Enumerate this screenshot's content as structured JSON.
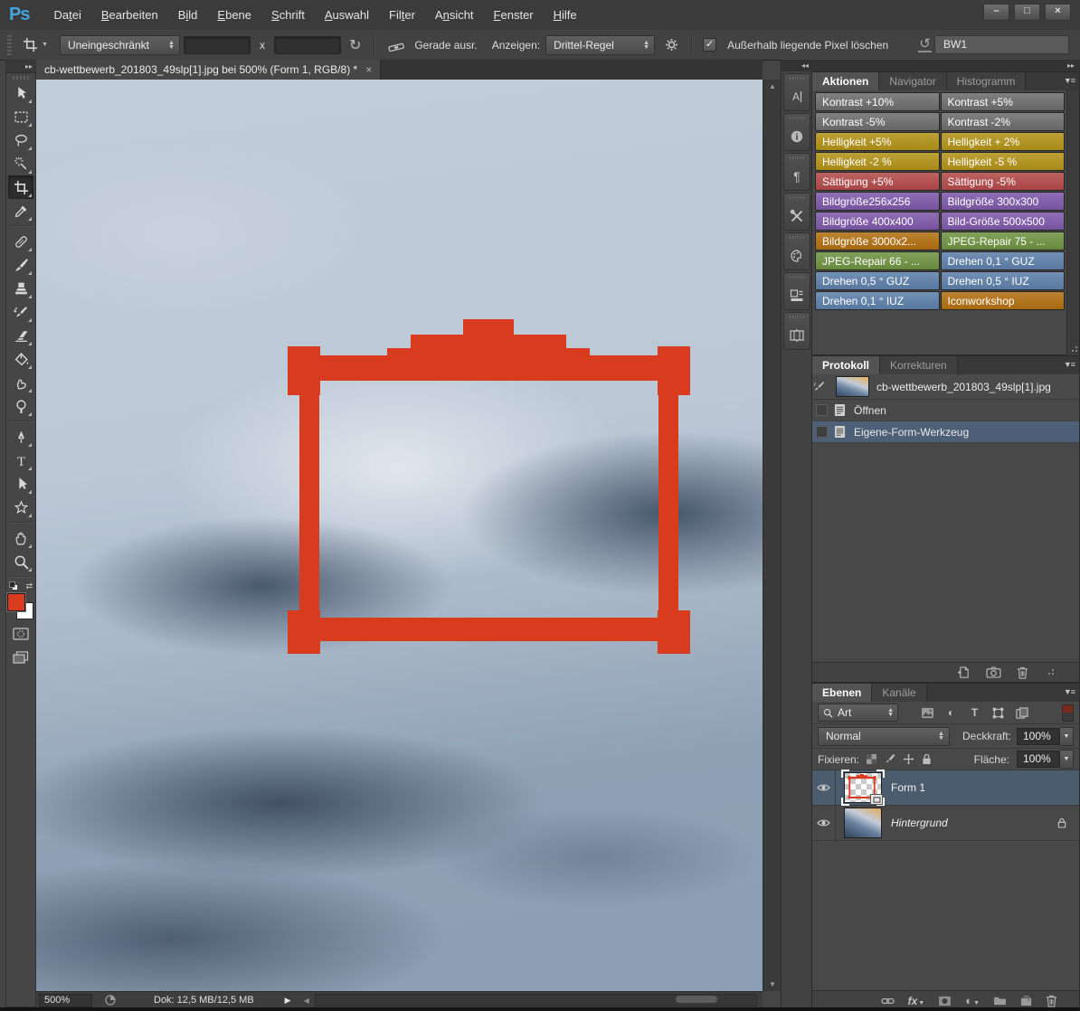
{
  "window": {
    "controls": [
      "–",
      "□",
      "×"
    ]
  },
  "menu_bar": {
    "logo": "Ps",
    "items": [
      {
        "label": "Datei",
        "u": 2
      },
      {
        "label": "Bearbeiten",
        "u": 0
      },
      {
        "label": "Bild",
        "u": 1
      },
      {
        "label": "Ebene",
        "u": 0
      },
      {
        "label": "Schrift",
        "u": 0
      },
      {
        "label": "Auswahl",
        "u": 0
      },
      {
        "label": "Filter",
        "u": 3
      },
      {
        "label": "Ansicht",
        "u": 1
      },
      {
        "label": "Fenster",
        "u": 0
      },
      {
        "label": "Hilfe",
        "u": 0
      }
    ]
  },
  "options_bar": {
    "tool": "crop",
    "aspect_select": "Uneingeschränkt",
    "width_value": "",
    "x_label": "x",
    "height_value": "",
    "straighten_label": "Gerade ausr.",
    "view_label": "Anzeigen:",
    "overlay_select": "Drittel-Regel",
    "delete_checkbox": {
      "checked": true,
      "check_glyph": "✓",
      "label": "Außerhalb liegende Pixel löschen"
    },
    "workspace_value": "BW1"
  },
  "toolbar": {
    "tools": [
      {
        "name": "move"
      },
      {
        "name": "rectangular-marquee"
      },
      {
        "name": "lasso"
      },
      {
        "name": "magic-wand"
      },
      {
        "name": "crop",
        "selected": true
      },
      {
        "name": "eyedropper"
      },
      {
        "sep": true
      },
      {
        "name": "spot-healing-brush"
      },
      {
        "name": "brush"
      },
      {
        "name": "clone-stamp"
      },
      {
        "name": "history-brush"
      },
      {
        "name": "eraser"
      },
      {
        "name": "paint-bucket"
      },
      {
        "name": "smudge"
      },
      {
        "name": "dodge"
      },
      {
        "sep": true
      },
      {
        "name": "pen"
      },
      {
        "name": "type"
      },
      {
        "name": "path-selection"
      },
      {
        "name": "custom-shape"
      },
      {
        "sep": true
      },
      {
        "name": "hand"
      },
      {
        "name": "zoom"
      }
    ],
    "foreground_color": "#d93b1e",
    "background_color": "#ffffff"
  },
  "document_tab": {
    "title": "cb-wettbewerb_201803_49slp[1].jpg bei 500% (Form 1, RGB/8) *",
    "close_glyph": "×"
  },
  "panels": {
    "dock_icons": [
      {
        "name": "character-panel"
      },
      {
        "name": "info-panel"
      },
      {
        "name": "paragraph-panel"
      },
      {
        "name": "tool-presets-panel"
      },
      {
        "name": "swatches-panel"
      },
      {
        "name": "styles-panel"
      },
      {
        "name": "timeline-panel"
      }
    ],
    "actions": {
      "tabs": [
        "Aktionen",
        "Navigator",
        "Histogramm"
      ],
      "active_tab": "Aktionen",
      "buttons": [
        {
          "label": "Kontrast +10%",
          "color": "gray"
        },
        {
          "label": "Kontrast +5%",
          "color": "gray"
        },
        {
          "label": "Kontrast -5%",
          "color": "gray"
        },
        {
          "label": "Kontrast -2%",
          "color": "gray"
        },
        {
          "label": "Helligkeit +5%",
          "color": "gold"
        },
        {
          "label": "Helligkeit + 2%",
          "color": "gold"
        },
        {
          "label": "Helligkeit -2 %",
          "color": "gold"
        },
        {
          "label": "Helligkeit -5 %",
          "color": "gold"
        },
        {
          "label": "Sättigung +5%",
          "color": "red"
        },
        {
          "label": "Sättigung -5%",
          "color": "red"
        },
        {
          "label": "Bildgröße256x256",
          "color": "purple"
        },
        {
          "label": "Bildgröße 300x300",
          "color": "purple"
        },
        {
          "label": "Bildgröße 400x400",
          "color": "purple"
        },
        {
          "label": "Bild-Größe 500x500",
          "color": "purple"
        },
        {
          "label": "Bildgröße 3000x2...",
          "color": "orange"
        },
        {
          "label": "JPEG-Repair 75 - ...",
          "color": "green"
        },
        {
          "label": "JPEG-Repair 66 - ...",
          "color": "green"
        },
        {
          "label": "Drehen 0,1 ° GUZ",
          "color": "blue"
        },
        {
          "label": "Drehen 0,5 ° GUZ",
          "color": "blue"
        },
        {
          "label": "Drehen 0,5 ° IUZ",
          "color": "blue"
        },
        {
          "label": "Drehen 0,1 ° IUZ",
          "color": "blue"
        },
        {
          "label": "Iconworkshop",
          "color": "orange"
        }
      ]
    },
    "history": {
      "tabs": [
        "Protokoll",
        "Korrekturen"
      ],
      "active_tab": "Protokoll",
      "snapshot": "cb-wettbewerb_201803_49slp[1].jpg",
      "states": [
        {
          "label": "Öffnen",
          "selected": false
        },
        {
          "label": "Eigene-Form-Werkzeug",
          "selected": true
        }
      ]
    },
    "layers": {
      "tabs": [
        "Ebenen",
        "Kanäle"
      ],
      "active_tab": "Ebenen",
      "filter_select": "Art",
      "blend_mode": "Normal",
      "opacity_label": "Deckkraft:",
      "opacity_value": "100%",
      "lock_label": "Fixieren:",
      "fill_label": "Fläche:",
      "fill_value": "100%",
      "items": [
        {
          "name": "Form 1",
          "selected": true,
          "kind": "shape"
        },
        {
          "name": "Hintergrund",
          "italic": true,
          "locked": true,
          "kind": "photo"
        }
      ]
    }
  },
  "status_bar": {
    "zoom": "500%",
    "doc_size": "Dok: 12,5 MB/12,5 MB"
  },
  "colors": {
    "accent_red": "#d93b1e",
    "gray": "#6c6c6c",
    "gold": "#b19117",
    "red": "#b24848",
    "purple": "#7d57a8",
    "green": "#6d9140",
    "blue": "#5c7ea8",
    "orange": "#b06e10"
  }
}
